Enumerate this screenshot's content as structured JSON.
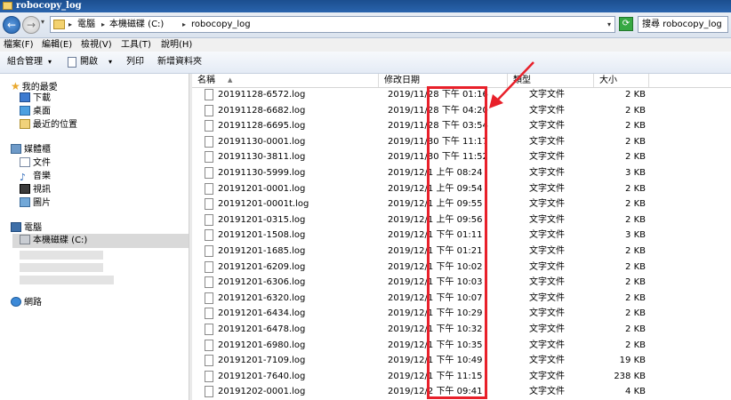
{
  "window": {
    "title": "robocopy_log"
  },
  "address": {
    "crumbs": [
      "電腦",
      "本機磁碟 (C:)",
      "robocopy_log"
    ],
    "search_placeholder": "搜尋 robocopy_log"
  },
  "menu": [
    "檔案(F)",
    "編輯(E)",
    "檢視(V)",
    "工具(T)",
    "說明(H)"
  ],
  "toolbar": {
    "organize": "組合管理",
    "open": "開啟",
    "print": "列印",
    "new_folder": "新增資料夾"
  },
  "nav": {
    "favorites": "我的最愛",
    "downloads": "下載",
    "desktop": "桌面",
    "recent": "最近的位置",
    "libraries": "媒體櫃",
    "documents": "文件",
    "music": "音樂",
    "videos": "視訊",
    "pictures": "圖片",
    "computer": "電腦",
    "local_disk": "本機磁碟 (C:)",
    "network": "網路"
  },
  "columns": {
    "name": "名稱",
    "date": "修改日期",
    "type": "類型",
    "size": "大小"
  },
  "files": [
    {
      "name": "20191128-6572.log",
      "date": "2019/11/28 下午 01:16",
      "type": "文字文件",
      "size": "2 KB"
    },
    {
      "name": "20191128-6682.log",
      "date": "2019/11/28 下午 04:20",
      "type": "文字文件",
      "size": "2 KB"
    },
    {
      "name": "20191128-6695.log",
      "date": "2019/11/28 下午 03:54",
      "type": "文字文件",
      "size": "2 KB"
    },
    {
      "name": "20191130-0001.log",
      "date": "2019/11/30 下午 11:17",
      "type": "文字文件",
      "size": "2 KB"
    },
    {
      "name": "20191130-3811.log",
      "date": "2019/11/30 下午 11:52",
      "type": "文字文件",
      "size": "2 KB"
    },
    {
      "name": "20191130-5999.log",
      "date": "2019/12/1 上午 08:24",
      "type": "文字文件",
      "size": "3 KB"
    },
    {
      "name": "20191201-0001.log",
      "date": "2019/12/1 上午 09:54",
      "type": "文字文件",
      "size": "2 KB"
    },
    {
      "name": "20191201-0001t.log",
      "date": "2019/12/1 上午 09:55",
      "type": "文字文件",
      "size": "2 KB"
    },
    {
      "name": "20191201-0315.log",
      "date": "2019/12/1 上午 09:56",
      "type": "文字文件",
      "size": "2 KB"
    },
    {
      "name": "20191201-1508.log",
      "date": "2019/12/1 下午 01:11",
      "type": "文字文件",
      "size": "3 KB"
    },
    {
      "name": "20191201-1685.log",
      "date": "2019/12/1 下午 01:21",
      "type": "文字文件",
      "size": "2 KB"
    },
    {
      "name": "20191201-6209.log",
      "date": "2019/12/1 下午 10:02",
      "type": "文字文件",
      "size": "2 KB"
    },
    {
      "name": "20191201-6306.log",
      "date": "2019/12/1 下午 10:03",
      "type": "文字文件",
      "size": "2 KB"
    },
    {
      "name": "20191201-6320.log",
      "date": "2019/12/1 下午 10:07",
      "type": "文字文件",
      "size": "2 KB"
    },
    {
      "name": "20191201-6434.log",
      "date": "2019/12/1 下午 10:29",
      "type": "文字文件",
      "size": "2 KB"
    },
    {
      "name": "20191201-6478.log",
      "date": "2019/12/1 下午 10:32",
      "type": "文字文件",
      "size": "2 KB"
    },
    {
      "name": "20191201-6980.log",
      "date": "2019/12/1 下午 10:35",
      "type": "文字文件",
      "size": "2 KB"
    },
    {
      "name": "20191201-7109.log",
      "date": "2019/12/1 下午 10:49",
      "type": "文字文件",
      "size": "19 KB"
    },
    {
      "name": "20191201-7640.log",
      "date": "2019/12/1 下午 11:15",
      "type": "文字文件",
      "size": "238 KB"
    },
    {
      "name": "20191202-0001.log",
      "date": "2019/12/2 下午 09:41",
      "type": "文字文件",
      "size": "4 KB"
    }
  ],
  "colors": {
    "annotation": "#e8202a",
    "titlebar": "#1b4e8f"
  }
}
